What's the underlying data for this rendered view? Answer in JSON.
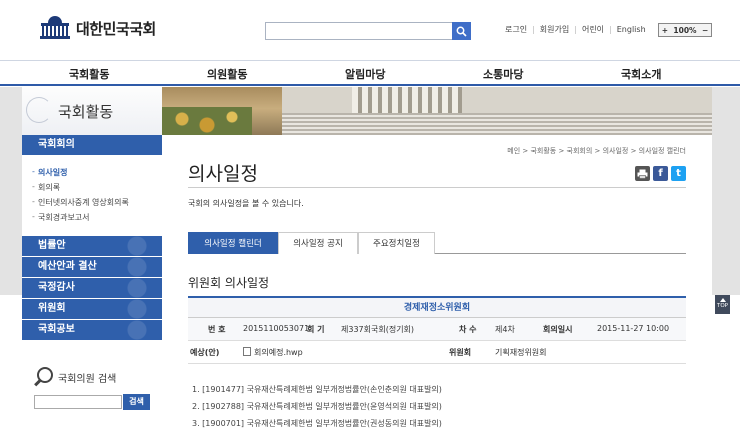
{
  "header": {
    "logo_text": "대한민국국회",
    "search_placeholder": "",
    "util_links": [
      "로그인",
      "회원가입",
      "어린이",
      "English"
    ],
    "zoom": {
      "plus": "+",
      "level": "100%",
      "minus": "−"
    }
  },
  "gnb": [
    "국회활동",
    "의원활동",
    "알림마당",
    "소통마당",
    "국회소개"
  ],
  "sidebar": {
    "title": "국회활동",
    "active": "국회회의",
    "sub_items": [
      {
        "label": "의사일정",
        "on": true
      },
      {
        "label": "회의록",
        "on": false
      },
      {
        "label": "인터넷의사중계 영상회의록",
        "on": false
      },
      {
        "label": "국회경과보고서",
        "on": false
      }
    ],
    "menus": [
      "법률안",
      "예산안과 결산",
      "국정감사",
      "위원회",
      "국회공보"
    ],
    "member_search": {
      "label": "국회의원 검색",
      "button": "검색"
    }
  },
  "content": {
    "breadcrumb": "메인 > 국회활동 > 국회회의 > 의사일정 > 의사일정 캘린더",
    "title": "의사일정",
    "tools": {
      "print": "print-icon",
      "facebook": "f",
      "twitter": "t"
    },
    "description": "국회의 의사일정을 볼 수 있습니다.",
    "tabs": [
      {
        "label": "의사일정 캘린더",
        "on": true
      },
      {
        "label": "의사일정 공지",
        "on": false
      },
      {
        "label": "주요정치일정",
        "on": false
      }
    ],
    "section_title": "위원회 의사일정",
    "table": {
      "committee": "경제재정소위원회",
      "row1": {
        "num_label": "번 호",
        "num": "2015110053071",
        "session_label": "회 기",
        "session": "제337회국회(정기회)",
        "order_label": "차 수",
        "order": "제4차",
        "date_label": "회의일시",
        "date": "2015-11-27 10:00"
      },
      "row2": {
        "agenda_label": "예상(안)",
        "file": "회의예정.hwp",
        "committee_label": "위원회",
        "committee_name": "기획재정위원회"
      }
    },
    "agenda_items": [
      "1. [1901477] 국유재산특례제한법 일부개정법률안(손인춘의원 대표발의)",
      "2. [1902788] 국유재산특례제한법 일부개정법률안(윤영석의원 대표발의)",
      "3. [1900701] 국유재산특례제한법 일부개정법률안(권성동의원 대표발의)"
    ]
  },
  "top_button": "TOP",
  "colors": {
    "accent": "#2f5fab",
    "search_btn": "#3f6ec8",
    "facebook": "#3b5998",
    "twitter": "#1da1f2"
  }
}
